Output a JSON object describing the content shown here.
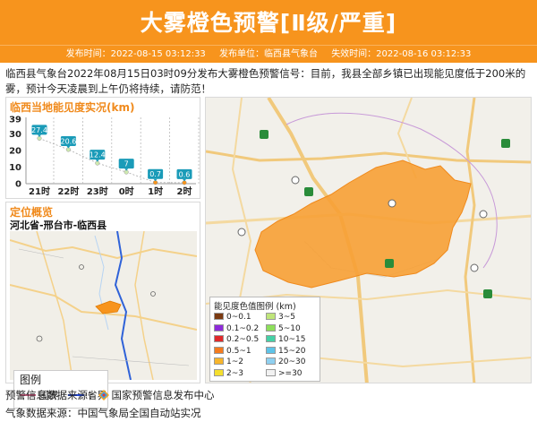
{
  "header": {
    "title": "大雾橙色预警[Ⅱ级/严重]",
    "issue_time": "发布时间：2022-08-15 03:12:33",
    "issuer": "发布单位：临西县气象台",
    "expire_time": "失效时间：2022-08-16 03:12:33",
    "bg_color": "#f7941d"
  },
  "summary": "临西县气象台2022年08月15日03时09分发布大雾橙色预警信号：目前，我县全部乡镇已出现能见度低于200米的雾，预计今天凌晨到上午仍将持续，请防范！",
  "visibility_panel": {
    "title": "临西当地能见度实况(km)"
  },
  "chart_data": {
    "type": "line",
    "title": "临西当地能见度实况(km)",
    "categories": [
      "21时",
      "22时",
      "23时",
      "0时",
      "1时",
      "2时"
    ],
    "series": [
      {
        "values": [
          27.4,
          20.6,
          12.4,
          7,
          0.7,
          0.6
        ]
      }
    ],
    "data_labels": [
      "27.4",
      "20.6",
      "12.4",
      "7",
      "0.7",
      "0.6"
    ],
    "yticks": [
      "0",
      "10",
      "20",
      "30",
      "39"
    ],
    "ylim": [
      0,
      39
    ],
    "grid": "vertical dashed",
    "label_color": "#1a9bb8",
    "point_colors": [
      "#cfe9b0",
      "#cfe9b0",
      "#cfe9b0",
      "#cfe9b0",
      "#f7941d",
      "#f7941d"
    ]
  },
  "overview": {
    "title": "定位概览",
    "location": "河北省-邢台市-临西县",
    "legend_title": "图例",
    "legend_country": "国界",
    "legend_province": "省界"
  },
  "visibility_legend": {
    "title": "能见度色值图例 (km)",
    "items": [
      {
        "label": "0~0.1",
        "color": "#7b3a12"
      },
      {
        "label": "3~5",
        "color": "#bfe57a"
      },
      {
        "label": "0.1~0.2",
        "color": "#8e2bd9"
      },
      {
        "label": "5~10",
        "color": "#8ddf5b"
      },
      {
        "label": "0.2~0.5",
        "color": "#e0282a"
      },
      {
        "label": "10~15",
        "color": "#45d1a6"
      },
      {
        "label": "0.5~1",
        "color": "#f47b1f"
      },
      {
        "label": "15~20",
        "color": "#5ec3e8"
      },
      {
        "label": "1~2",
        "color": "#f7b52c"
      },
      {
        "label": "20~30",
        "color": "#8fd0f0"
      },
      {
        "label": "2~3",
        "color": "#f5df2e"
      },
      {
        "label": ">=30",
        "color": "#f2f2f2"
      }
    ]
  },
  "sources": {
    "warning": "预警信息数据来源：",
    "warning_org": "国家预警信息发布中心",
    "weather": "气象数据来源：中国气象局全国自动站实况"
  }
}
